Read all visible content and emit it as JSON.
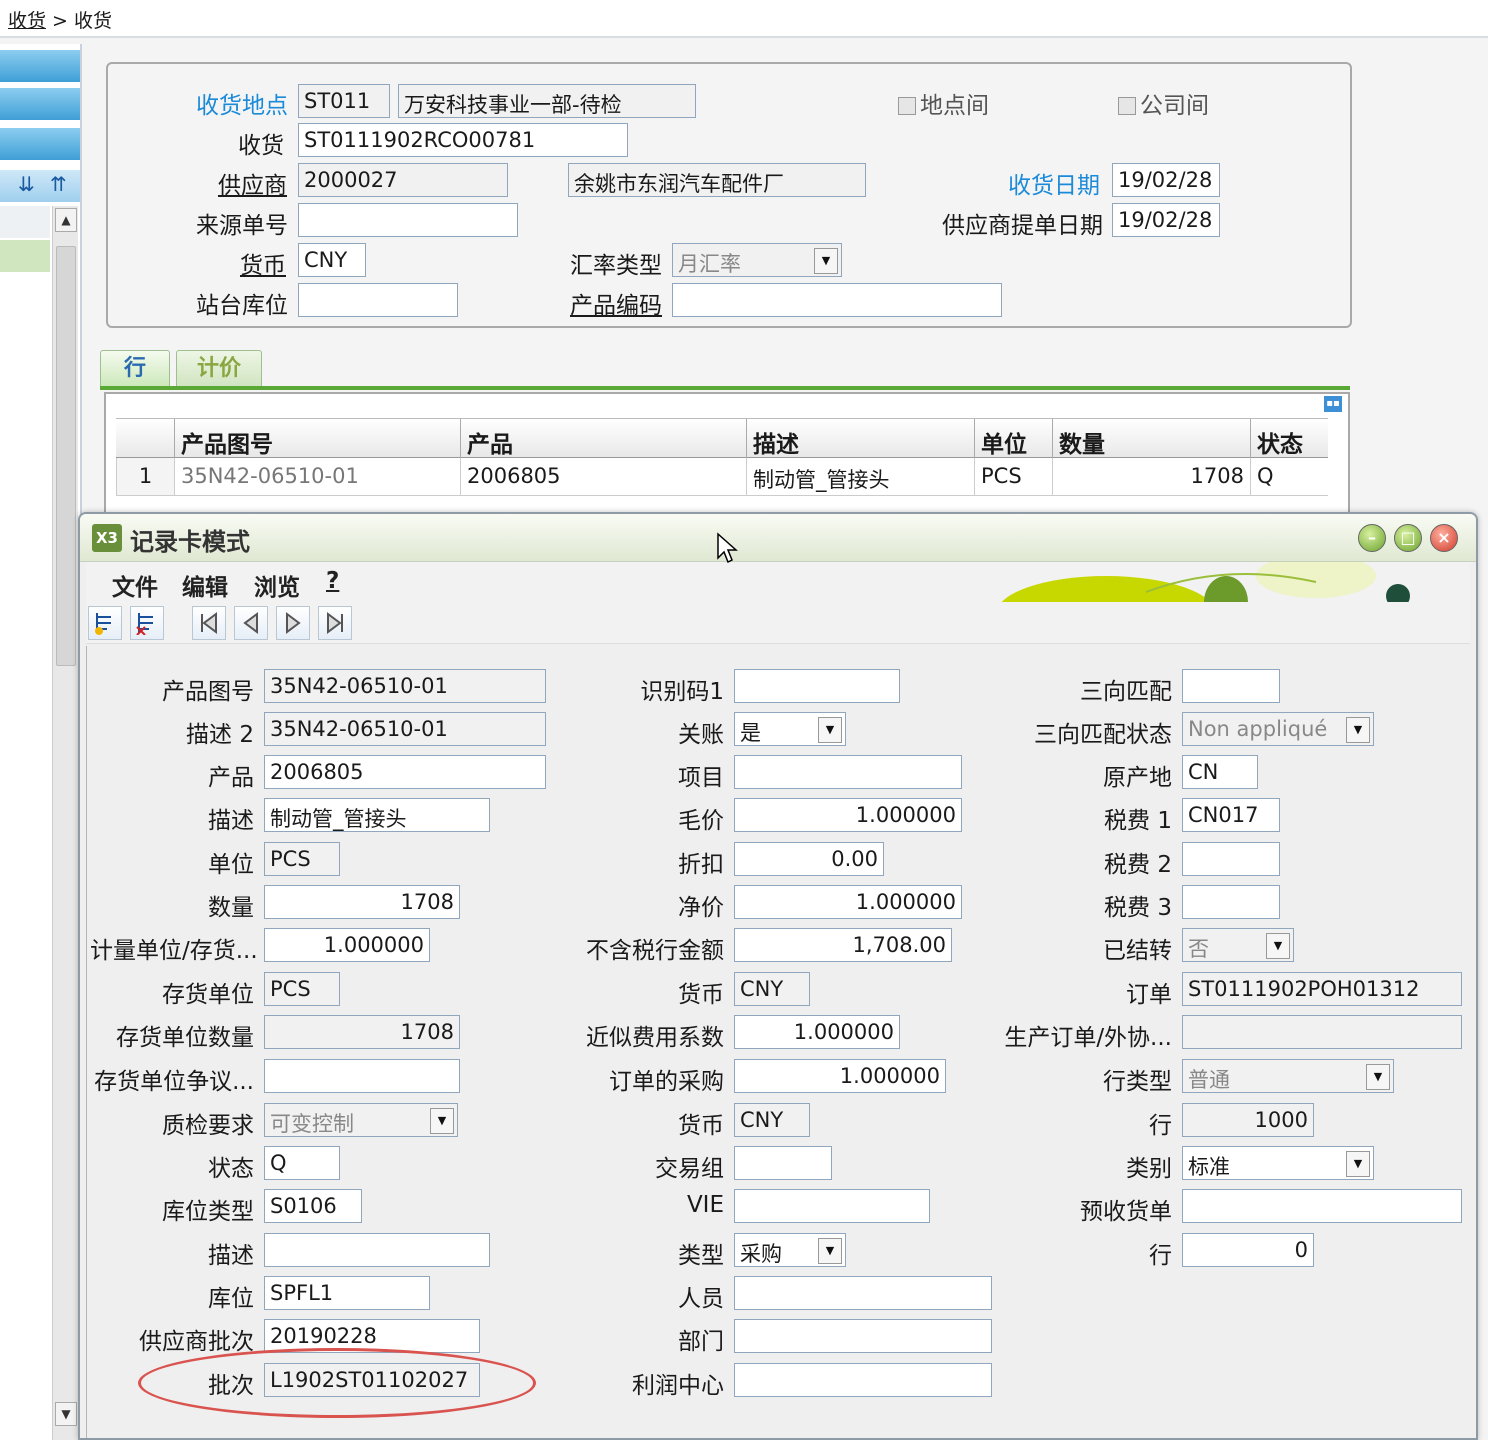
{
  "breadcrumb": {
    "first": "收货",
    "sep": ">",
    "second": "收货"
  },
  "header": {
    "site_label": "收货地点",
    "site_code": "ST011",
    "site_name": "万安科技事业一部-待检",
    "receipt_label": "收货",
    "receipt_no": "ST0111902RCO00781",
    "supplier_label": "供应商",
    "supplier_code": "2000027",
    "supplier_name": "余姚市东润汽车配件厂",
    "source_label": "来源单号",
    "source_value": "",
    "currency_label": "货币",
    "currency_value": "CNY",
    "rate_type_label": "汇率类型",
    "rate_type_value": "月汇率",
    "station_label": "站台库位",
    "station_value": "",
    "product_code_label": "产品编码",
    "product_code_value": "",
    "chk_intersite": "地点间",
    "chk_intercompany": "公司间",
    "date_label": "收货日期",
    "date_value": "19/02/28",
    "supplier_date_label": "供应商提单日期",
    "supplier_date_value": "19/02/28"
  },
  "tabs": {
    "lines": "行",
    "pricing": "计价"
  },
  "grid": {
    "headers": [
      "产品图号",
      "产品",
      "描述",
      "单位",
      "数量",
      "状态"
    ],
    "rows": [
      {
        "idx": "1",
        "drawing": "35N42-06510-01",
        "product": "2006805",
        "desc": "制动管_管接头",
        "unit": "PCS",
        "qty": "1708",
        "status": "Q"
      }
    ]
  },
  "window": {
    "title": "记录卡模式",
    "logo": "X3",
    "menu": [
      "文件",
      "编辑",
      "浏览",
      "?"
    ]
  },
  "card": {
    "col1": [
      {
        "label": "产品图号",
        "value": "35N42-06510-01"
      },
      {
        "label": "描述 2",
        "value": "35N42-06510-01"
      },
      {
        "label": "产品",
        "value": "2006805"
      },
      {
        "label": "描述",
        "value": "制动管_管接头"
      },
      {
        "label": "单位",
        "value": "PCS"
      },
      {
        "label": "数量",
        "value": "1708"
      },
      {
        "label": "计量单位/存货...",
        "value": "1.000000"
      },
      {
        "label": "存货单位",
        "value": "PCS"
      },
      {
        "label": "存货单位数量",
        "value": "1708"
      },
      {
        "label": "存货单位争议...",
        "value": ""
      },
      {
        "label": "质检要求",
        "value": "可变控制"
      },
      {
        "label": "状态",
        "value": "Q"
      },
      {
        "label": "库位类型",
        "value": "S0106"
      },
      {
        "label": "描述",
        "value": ""
      },
      {
        "label": "库位",
        "value": "SPFL1"
      },
      {
        "label": "供应商批次",
        "value": "20190228"
      },
      {
        "label": "批次",
        "value": "L1902ST01102027"
      }
    ],
    "col2": [
      {
        "label": "识别码1",
        "value": ""
      },
      {
        "label": "关账",
        "value": "是"
      },
      {
        "label": "项目",
        "value": ""
      },
      {
        "label": "毛价",
        "value": "1.000000"
      },
      {
        "label": "折扣",
        "value": "0.00"
      },
      {
        "label": "净价",
        "value": "1.000000"
      },
      {
        "label": "不含税行金额",
        "value": "1,708.00"
      },
      {
        "label": "货币",
        "value": "CNY"
      },
      {
        "label": "近似费用系数",
        "value": "1.000000"
      },
      {
        "label": "订单的采购",
        "value": "1.000000"
      },
      {
        "label": "货币",
        "value": "CNY"
      },
      {
        "label": "交易组",
        "value": ""
      },
      {
        "label": "VIE",
        "value": ""
      },
      {
        "label": "类型",
        "value": "采购"
      },
      {
        "label": "人员",
        "value": ""
      },
      {
        "label": "部门",
        "value": ""
      },
      {
        "label": "利润中心",
        "value": ""
      }
    ],
    "col3": [
      {
        "label": "三向匹配",
        "value": ""
      },
      {
        "label": "三向匹配状态",
        "value": "Non appliqué"
      },
      {
        "label": "原产地",
        "value": "CN"
      },
      {
        "label": "税费 1",
        "value": "CN017"
      },
      {
        "label": "税费 2",
        "value": ""
      },
      {
        "label": "税费 3",
        "value": ""
      },
      {
        "label": "已结转",
        "value": "否"
      },
      {
        "label": "订单",
        "value": "ST0111902POH01312"
      },
      {
        "label": "生产订单/外协...",
        "value": ""
      },
      {
        "label": "行类型",
        "value": "普通"
      },
      {
        "label": "行",
        "value": "1000"
      },
      {
        "label": "类别",
        "value": "标准"
      },
      {
        "label": "预收货单",
        "value": ""
      },
      {
        "label": "行",
        "value": "0"
      }
    ]
  },
  "colors": {
    "accent_blue": "#1b8ad8",
    "tab_green": "#5aa835",
    "highlight_red": "#d9534f"
  }
}
